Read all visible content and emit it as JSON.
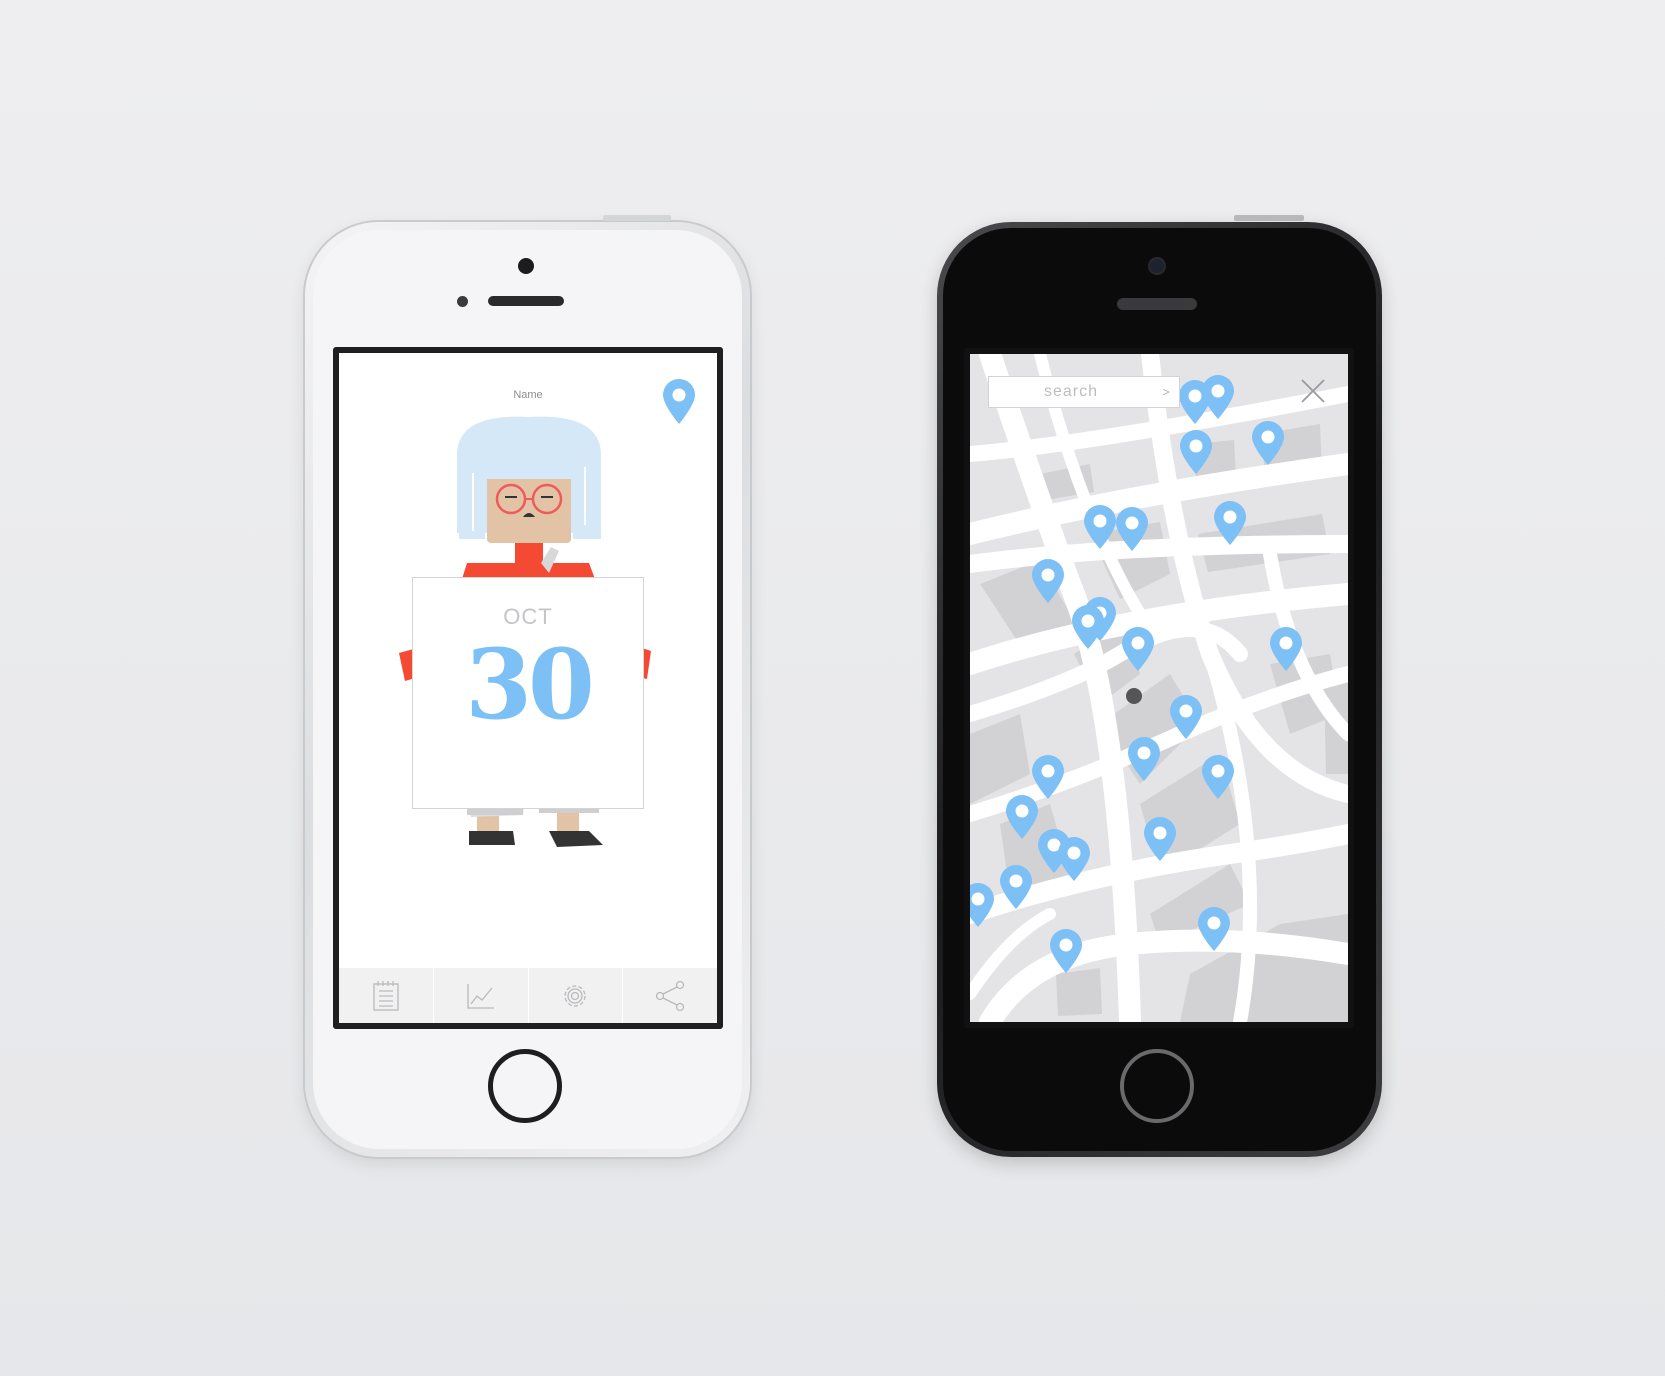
{
  "calendar_screen": {
    "name_label": "Name",
    "month": "OCT",
    "day": "30",
    "tabs": [
      {
        "icon": "notepad-icon"
      },
      {
        "icon": "chart-icon"
      },
      {
        "icon": "gear-icon"
      },
      {
        "icon": "share-icon"
      }
    ],
    "colors": {
      "accent": "#7cc0f5",
      "hair": "#d4e8f7",
      "shirt": "#f44a33"
    }
  },
  "map_screen": {
    "search": {
      "placeholder": "search",
      "go_label": ">"
    },
    "pin_color": "#7cc0f5",
    "close_icon": "close-icon"
  }
}
